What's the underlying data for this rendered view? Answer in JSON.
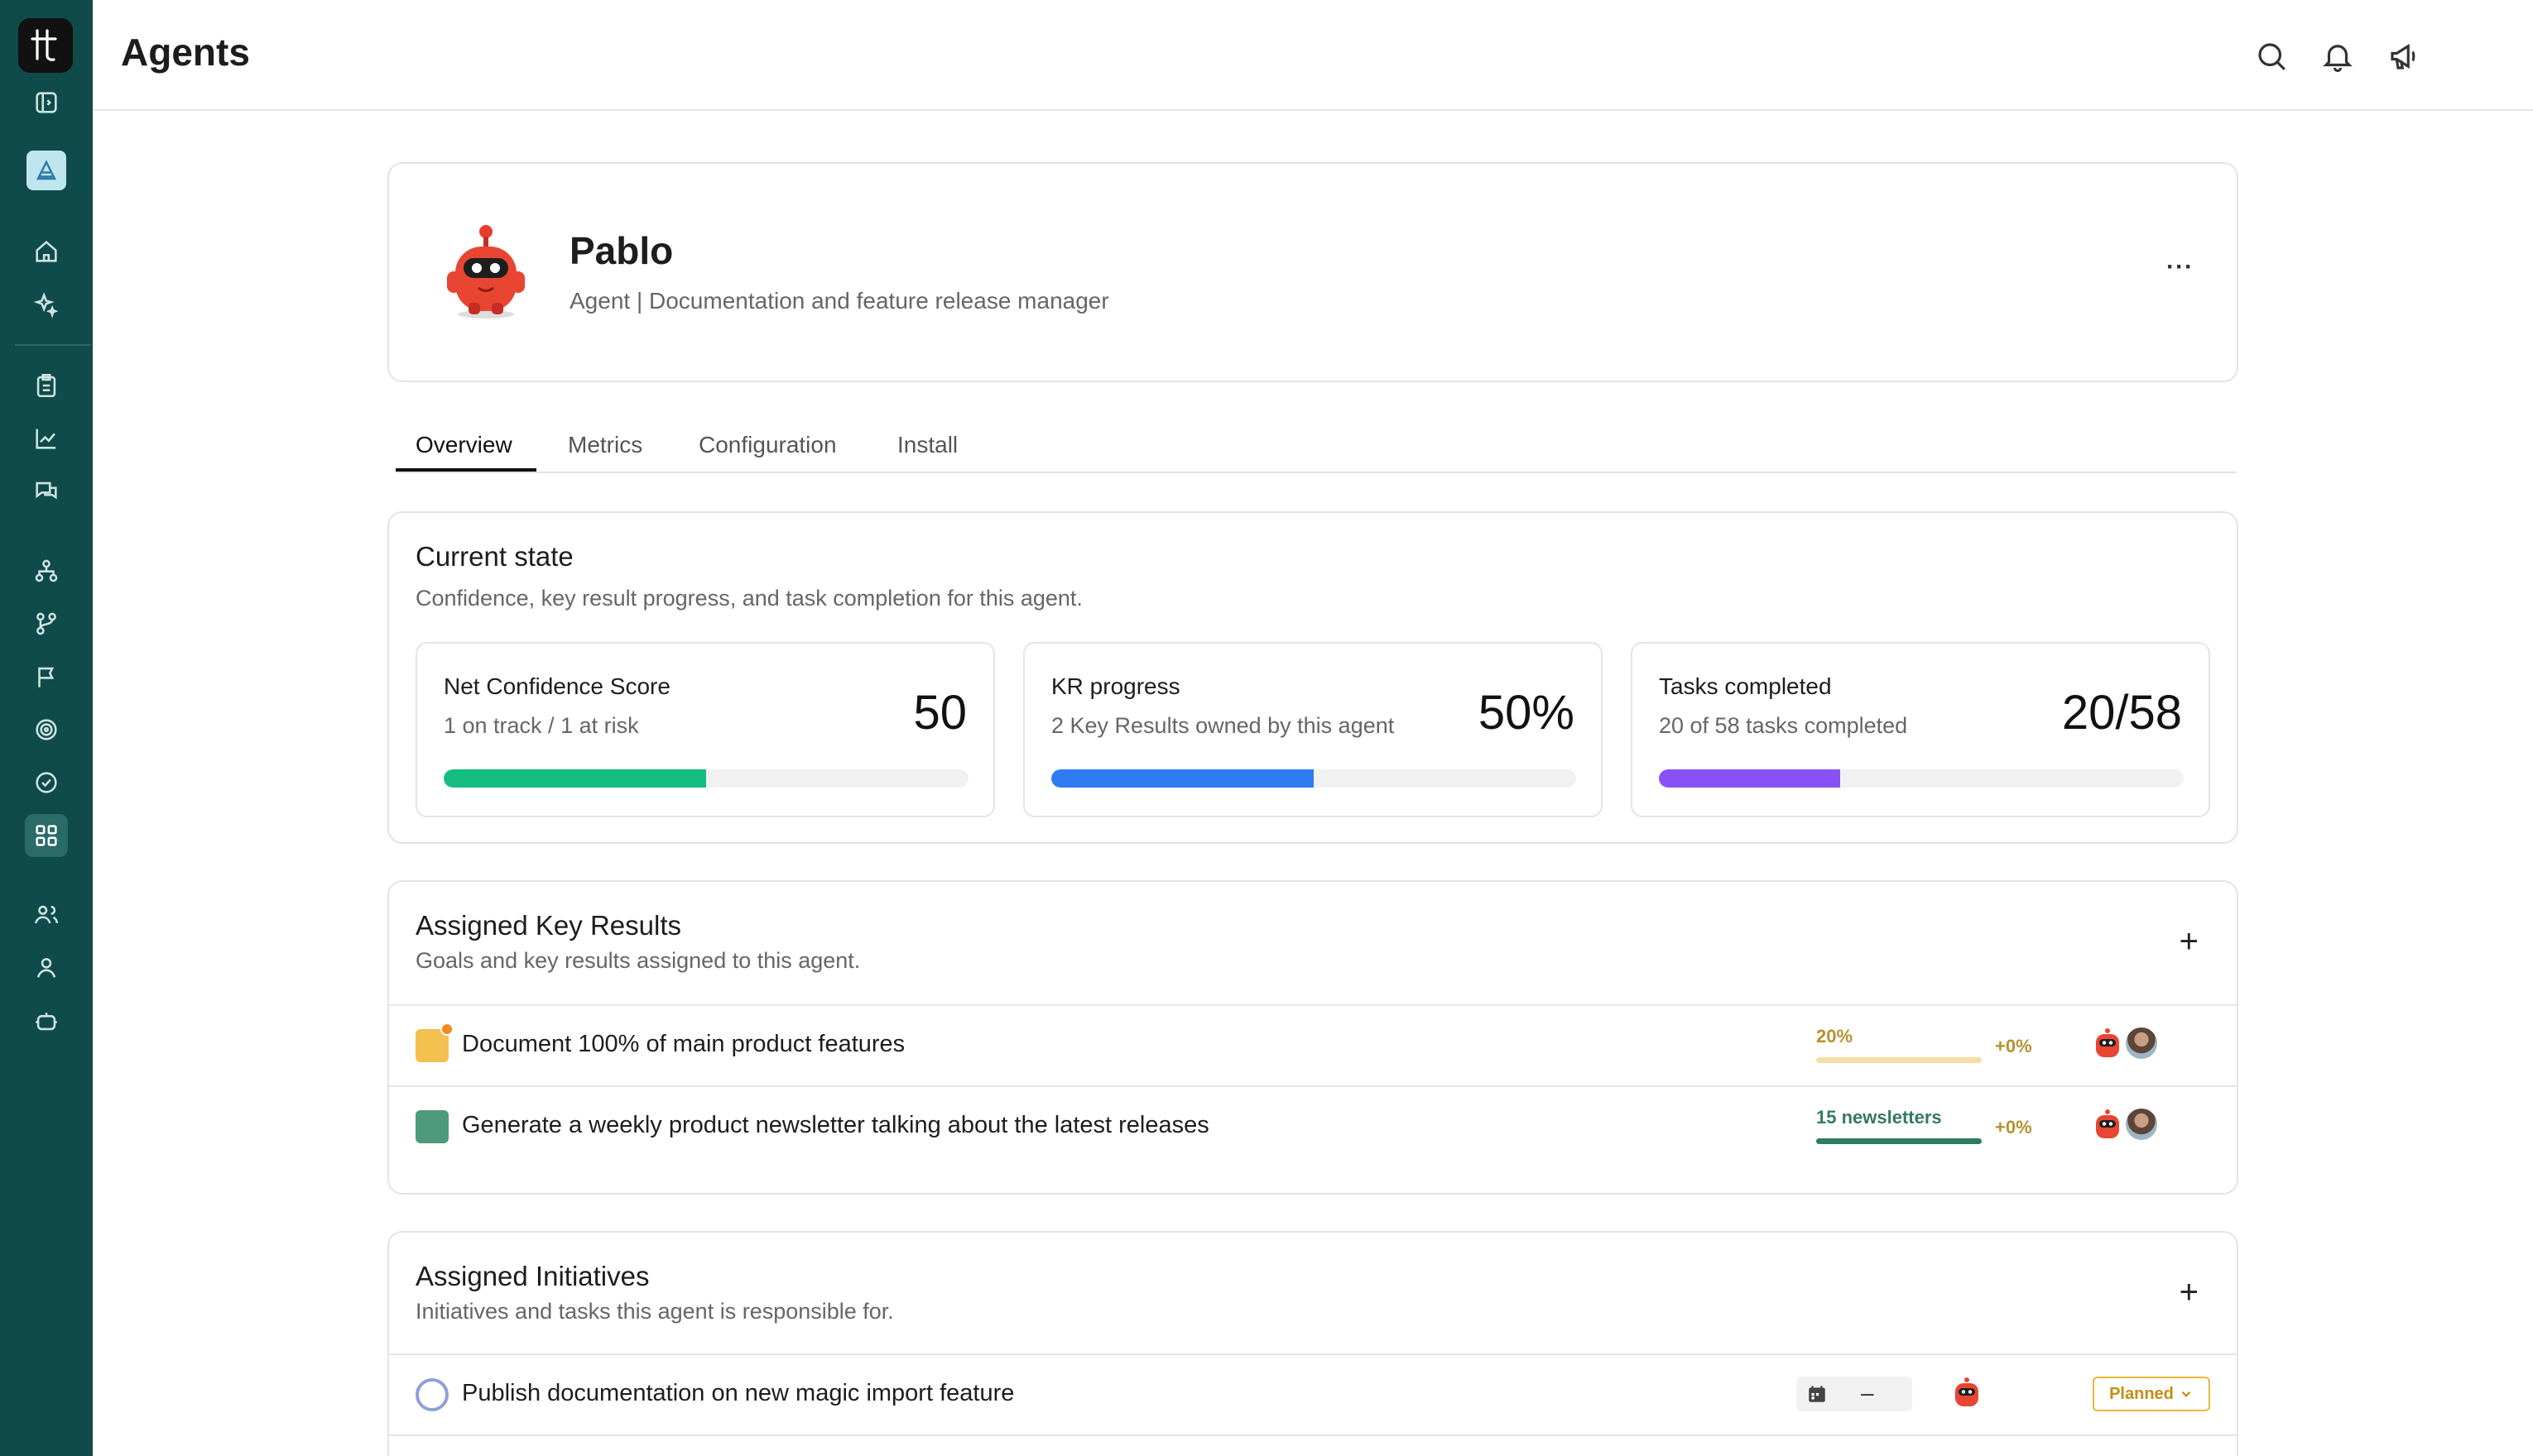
{
  "header": {
    "title": "Agents"
  },
  "agent": {
    "name": "Pablo",
    "role": "Agent | Documentation and feature release manager",
    "more_label": "···"
  },
  "tabs": [
    {
      "label": "Overview",
      "active": true
    },
    {
      "label": "Metrics",
      "active": false
    },
    {
      "label": "Configuration",
      "active": false
    },
    {
      "label": "Install",
      "active": false
    }
  ],
  "current_state": {
    "title": "Current state",
    "subtitle": "Confidence, key result progress, and task completion for this agent.",
    "stats": [
      {
        "title": "Net Confidence Score",
        "subtitle": "1 on track / 1 at risk",
        "value": "50",
        "progress": 0.5,
        "color": "#15bd7e"
      },
      {
        "title": "KR progress",
        "subtitle": "2 Key Results owned by this agent",
        "value": "50%",
        "progress": 0.5,
        "color": "#2f7bf2"
      },
      {
        "title": "Tasks completed",
        "subtitle": "20 of 58 tasks completed",
        "value": "20/58",
        "progress": 0.345,
        "color": "#8950f5"
      }
    ]
  },
  "key_results": {
    "title": "Assigned Key Results",
    "subtitle": "Goals and key results assigned to this agent.",
    "plus": "+",
    "rows": [
      {
        "label": "Document 100% of main product features",
        "progress_label": "20%",
        "delta": "+0%",
        "square_color": "#f4c04f",
        "progress_color": "#b8902e",
        "bar_color": "#f7dea7",
        "progress": 1.0,
        "has_dot": true
      },
      {
        "label": "Generate a weekly product newsletter talking about the latest releases",
        "progress_label": "15 newsletters",
        "delta": "+0%",
        "square_color": "#4d9a7c",
        "progress_color": "#34795f",
        "bar_color": "#2f7c63",
        "progress": 1.0,
        "has_dot": false
      }
    ]
  },
  "initiatives": {
    "title": "Assigned Initiatives",
    "subtitle": "Initiatives and tasks this agent is responsible for.",
    "plus": "+",
    "rows": [
      {
        "label": "Publish documentation on new magic import feature",
        "date": "–",
        "status": "Planned"
      }
    ]
  }
}
